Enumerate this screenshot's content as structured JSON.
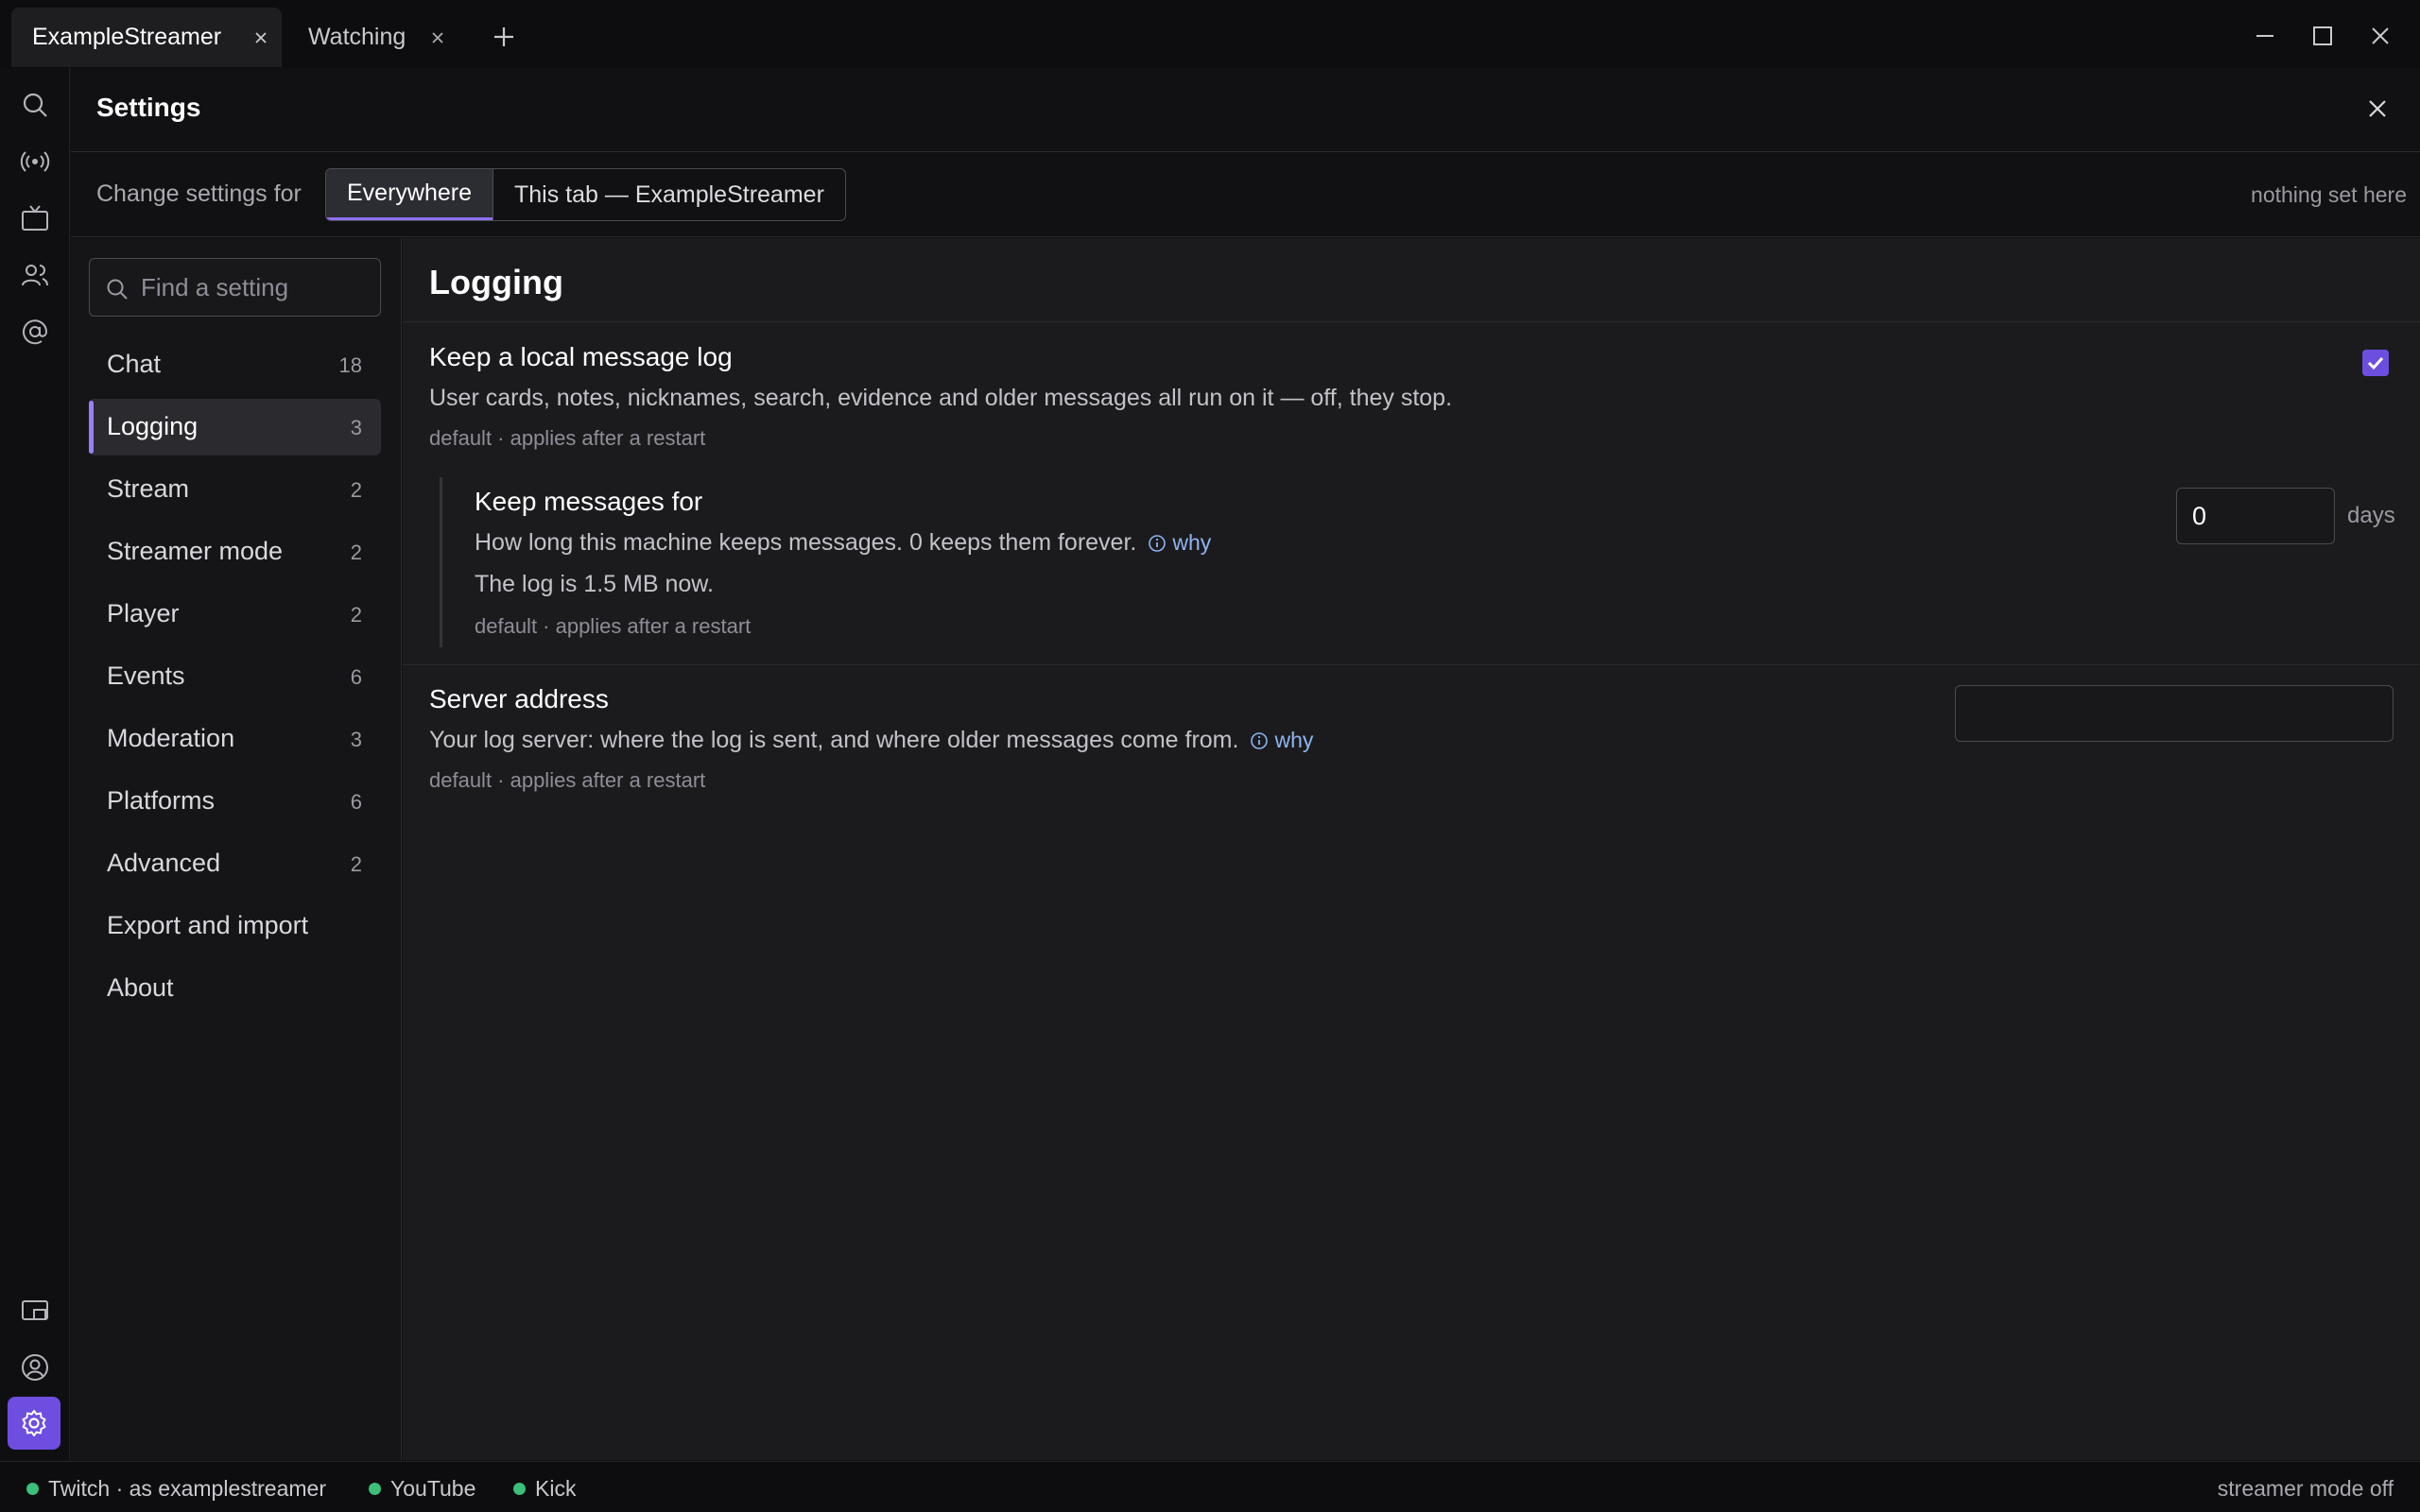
{
  "tabs": [
    {
      "label": "ExampleStreamer",
      "active": true
    },
    {
      "label": "Watching",
      "active": false
    }
  ],
  "rail": {
    "top": [
      "search-icon",
      "broadcast-icon",
      "tv-icon",
      "users-icon",
      "at-sign-icon"
    ],
    "bottom": [
      "popout-icon",
      "account-icon",
      "settings-icon"
    ]
  },
  "settings": {
    "title": "Settings",
    "scope": {
      "label": "Change settings for",
      "options": [
        "Everywhere",
        "This tab — ExampleStreamer"
      ],
      "selected": "Everywhere",
      "note": "nothing set here"
    },
    "search_placeholder": "Find a setting",
    "nav": [
      {
        "label": "Chat",
        "count": "18"
      },
      {
        "label": "Logging",
        "count": "3",
        "active": true
      },
      {
        "label": "Stream",
        "count": "2"
      },
      {
        "label": "Streamer mode",
        "count": "2"
      },
      {
        "label": "Player",
        "count": "2"
      },
      {
        "label": "Events",
        "count": "6"
      },
      {
        "label": "Moderation",
        "count": "3"
      },
      {
        "label": "Platforms",
        "count": "6"
      },
      {
        "label": "Advanced",
        "count": "2"
      },
      {
        "label": "Export and import",
        "count": ""
      },
      {
        "label": "About",
        "count": ""
      }
    ],
    "section": {
      "title": "Logging",
      "local_log": {
        "title": "Keep a local message log",
        "desc": "User cards, notes, nicknames, search, evidence and older messages all run on it — off, they stop.",
        "meta": "default · applies after a restart",
        "checked": true
      },
      "retention": {
        "title": "Keep messages for",
        "desc": "How long this machine keeps messages. 0 keeps them forever.",
        "why": "why",
        "size_note": "The log is 1.5 MB now.",
        "meta": "default · applies after a restart",
        "value": "0",
        "unit": "days"
      },
      "server": {
        "title": "Server address",
        "desc": "Your log server: where the log is sent, and where older messages come from.",
        "why": "why",
        "meta": "default · applies after a restart",
        "value": ""
      }
    }
  },
  "statusbar": {
    "platforms": [
      {
        "label": "Twitch · as examplestreamer",
        "color": "#3bbf7a"
      },
      {
        "label": "YouTube",
        "color": "#3bbf7a"
      },
      {
        "label": "Kick",
        "color": "#3bbf7a"
      }
    ],
    "streamer_mode": "streamer mode off"
  },
  "colors": {
    "accent": "#6d4ee0",
    "accent_light": "#9a80f5",
    "link": "#8fb4f0",
    "online": "#3bbf7a"
  }
}
